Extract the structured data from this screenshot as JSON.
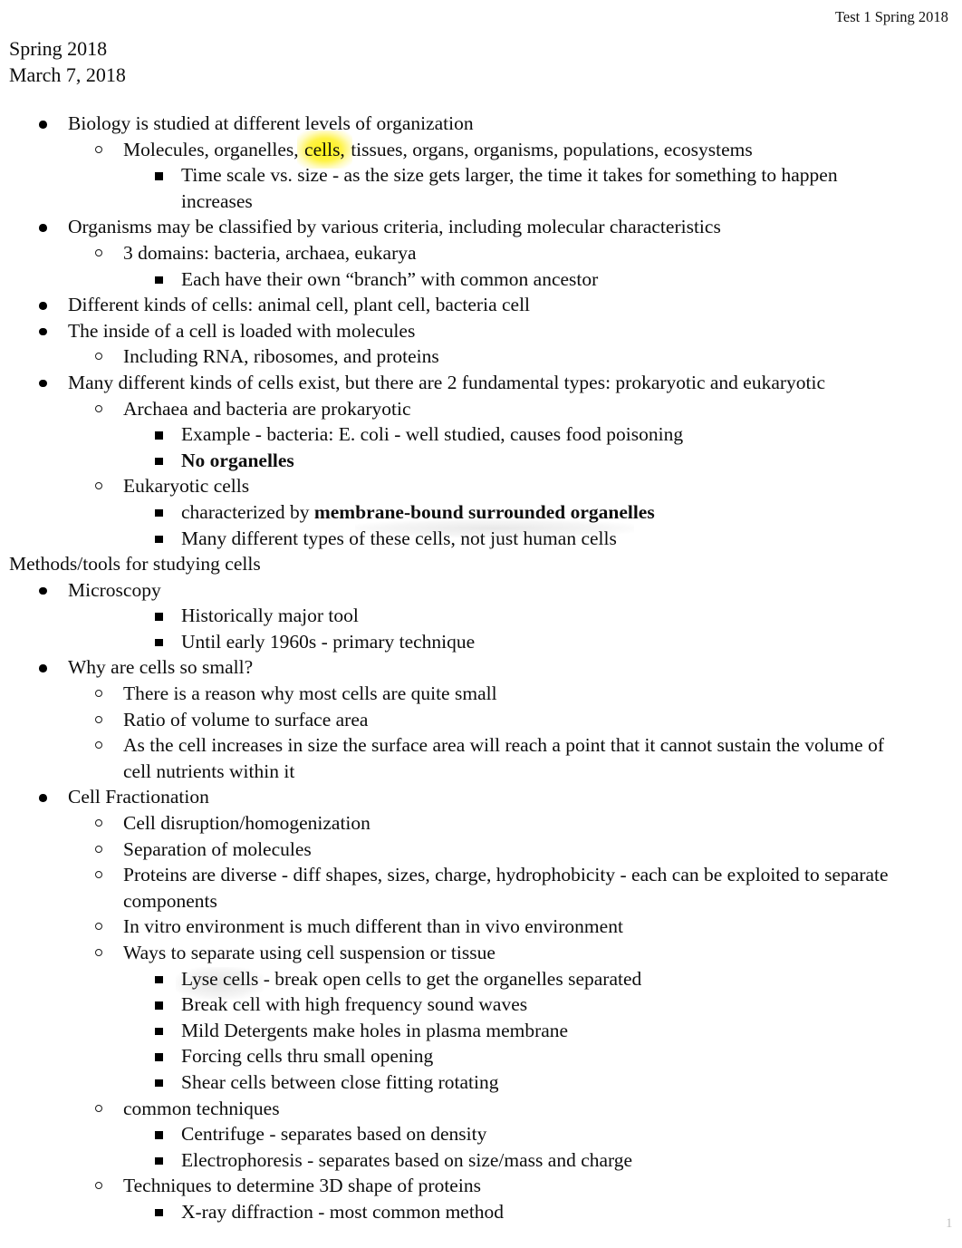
{
  "document": {
    "running_header": "Test 1 Spring 2018",
    "title_lines": [
      "Spring 2018",
      "March 7, 2018"
    ],
    "page_number": "1",
    "highlight_color": "#fff100",
    "text_color": "#0d0d0d"
  },
  "outline": [
    {
      "level": 1,
      "text": "Biology is studied at different levels of organization"
    },
    {
      "level": 2,
      "segments": [
        {
          "text": "Molecules, organelles, ",
          "style": "normal"
        },
        {
          "text": "cells,",
          "style": "highlight"
        },
        {
          "text": " tissues, organs, organisms, populations, ecosystems",
          "style": "normal"
        }
      ],
      "text": "Molecules, organelles, cells, tissues, organs, organisms, populations, ecosystems"
    },
    {
      "level": 3,
      "text": "Time scale vs. size - as the size gets larger, the time it takes for something to happen increases"
    },
    {
      "level": 1,
      "text": "Organisms may be classified by various criteria, including molecular characteristics"
    },
    {
      "level": 2,
      "text": "3 domains: bacteria, archaea, eukarya"
    },
    {
      "level": 3,
      "text": "Each have their own “branch” with common ancestor"
    },
    {
      "level": 1,
      "text": "Different kinds of cells: animal cell, plant cell, bacteria cell"
    },
    {
      "level": 1,
      "text": "The inside of a cell is loaded with molecules"
    },
    {
      "level": 2,
      "text": "Including RNA, ribosomes, and proteins"
    },
    {
      "level": 1,
      "text": "Many different kinds of cells exist, but there are 2 fundamental types: prokaryotic and eukaryotic"
    },
    {
      "level": 2,
      "text": "Archaea and bacteria are prokaryotic"
    },
    {
      "level": 3,
      "text": "Example - bacteria: E. coli - well studied, causes food poisoning"
    },
    {
      "level": 3,
      "text": "No organelles",
      "bold": true
    },
    {
      "level": 2,
      "text": "Eukaryotic cells"
    },
    {
      "level": 3,
      "segments": [
        {
          "text": "characterized by ",
          "style": "normal"
        },
        {
          "text": "membrane-bound surrounded organelles",
          "style": "bold-smudge"
        }
      ],
      "text": "characterized by membrane-bound surrounded organelles"
    },
    {
      "level": 3,
      "text": "Many different types of these cells, not just human cells"
    },
    {
      "level": 0,
      "text": "Methods/tools for studying cells"
    },
    {
      "level": 1,
      "text": "Microscopy"
    },
    {
      "level": 3,
      "text": "Historically major tool"
    },
    {
      "level": 3,
      "text": "Until early 1960s - primary technique"
    },
    {
      "level": 1,
      "text": "Why are cells so small?"
    },
    {
      "level": 2,
      "text": "There is a reason why most cells are quite small"
    },
    {
      "level": 2,
      "text": "Ratio of volume to surface area"
    },
    {
      "level": 2,
      "text": "As the cell increases in size the surface area will reach a point that it cannot sustain the volume of cell nutrients within it"
    },
    {
      "level": 1,
      "text": "Cell Fractionation"
    },
    {
      "level": 2,
      "text": "Cell disruption/homogenization"
    },
    {
      "level": 2,
      "text": "Separation of molecules"
    },
    {
      "level": 2,
      "text": "Proteins are diverse - diff shapes, sizes, charge, hydrophobicity - each can be exploited to separate components"
    },
    {
      "level": 2,
      "text": "In vitro environment is much different than in vivo environment"
    },
    {
      "level": 2,
      "text": "Ways to separate using cell suspension or tissue"
    },
    {
      "level": 3,
      "segments": [
        {
          "text": "Lyse cells",
          "style": "smudge"
        },
        {
          "text": " - break open cells to get the organelles separated",
          "style": "normal"
        }
      ],
      "text": "Lyse cells - break open cells to get the organelles separated"
    },
    {
      "level": 3,
      "text": "Break cell with high frequency sound waves"
    },
    {
      "level": 3,
      "text": "Mild Detergents make holes in plasma membrane"
    },
    {
      "level": 3,
      "text": "Forcing cells thru small opening"
    },
    {
      "level": 3,
      "text": "Shear cells between close fitting rotating"
    },
    {
      "level": 2,
      "text": "common techniques"
    },
    {
      "level": 3,
      "text": "Centrifuge - separates based on density"
    },
    {
      "level": 3,
      "text": "Electrophoresis - separates based on size/mass and charge"
    },
    {
      "level": 2,
      "text": "Techniques to determine 3D shape of proteins"
    },
    {
      "level": 3,
      "text": "X-ray diffraction - most common method"
    }
  ]
}
